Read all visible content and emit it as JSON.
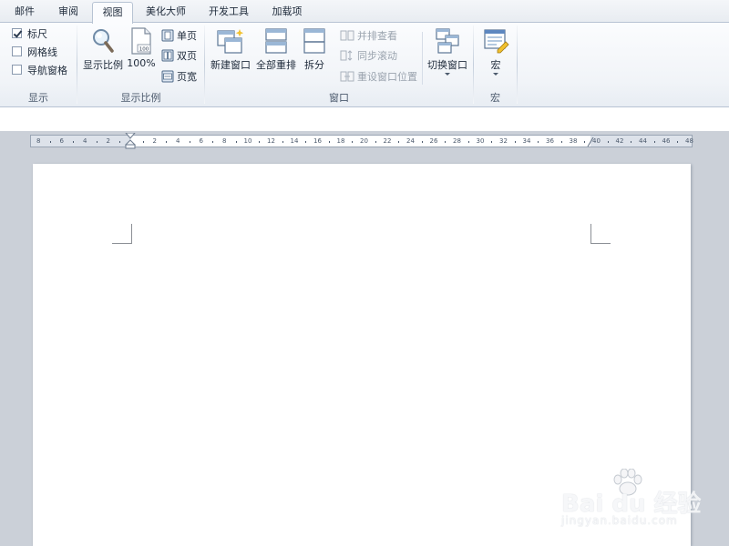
{
  "tabs": [
    {
      "label": "邮件",
      "active": false
    },
    {
      "label": "审阅",
      "active": false
    },
    {
      "label": "视图",
      "active": true
    },
    {
      "label": "美化大师",
      "active": false
    },
    {
      "label": "开发工具",
      "active": false
    },
    {
      "label": "加载项",
      "active": false
    }
  ],
  "ribbon": {
    "show_group": {
      "label": "显示",
      "ruler": {
        "label": "标尺",
        "checked": true
      },
      "gridlines": {
        "label": "网格线",
        "checked": false
      },
      "nav_pane": {
        "label": "导航窗格",
        "checked": false
      }
    },
    "zoom_group": {
      "label": "显示比例",
      "zoom_label": "显示比例",
      "percent_label": "100%",
      "percent_icon_text": "100",
      "one_page": "单页",
      "two_pages": "双页",
      "page_width": "页宽"
    },
    "window_group": {
      "label": "窗口",
      "new_window": "新建窗口",
      "arrange_all": "全部重排",
      "split": "拆分",
      "side_by_side": "并排查看",
      "sync_scroll": "同步滚动",
      "reset_position": "重设窗口位置",
      "switch_windows": "切换窗口"
    },
    "macros_group": {
      "label": "宏",
      "macros": "宏"
    }
  },
  "ruler_labels": [
    "8",
    "6",
    "4",
    "2",
    "",
    "2",
    "4",
    "6",
    "8",
    "10",
    "12",
    "14",
    "16",
    "18",
    "20",
    "22",
    "24",
    "26",
    "28",
    "30",
    "32",
    "34",
    "36",
    "38",
    "40",
    "42",
    "44",
    "46",
    "48"
  ],
  "watermark": {
    "main": "Bai du 经验",
    "sub": "jingyan.baidu.com"
  },
  "colors": {
    "accent": "#b7c3d3",
    "workspace": "#cbd0d8",
    "page": "#ffffff"
  }
}
